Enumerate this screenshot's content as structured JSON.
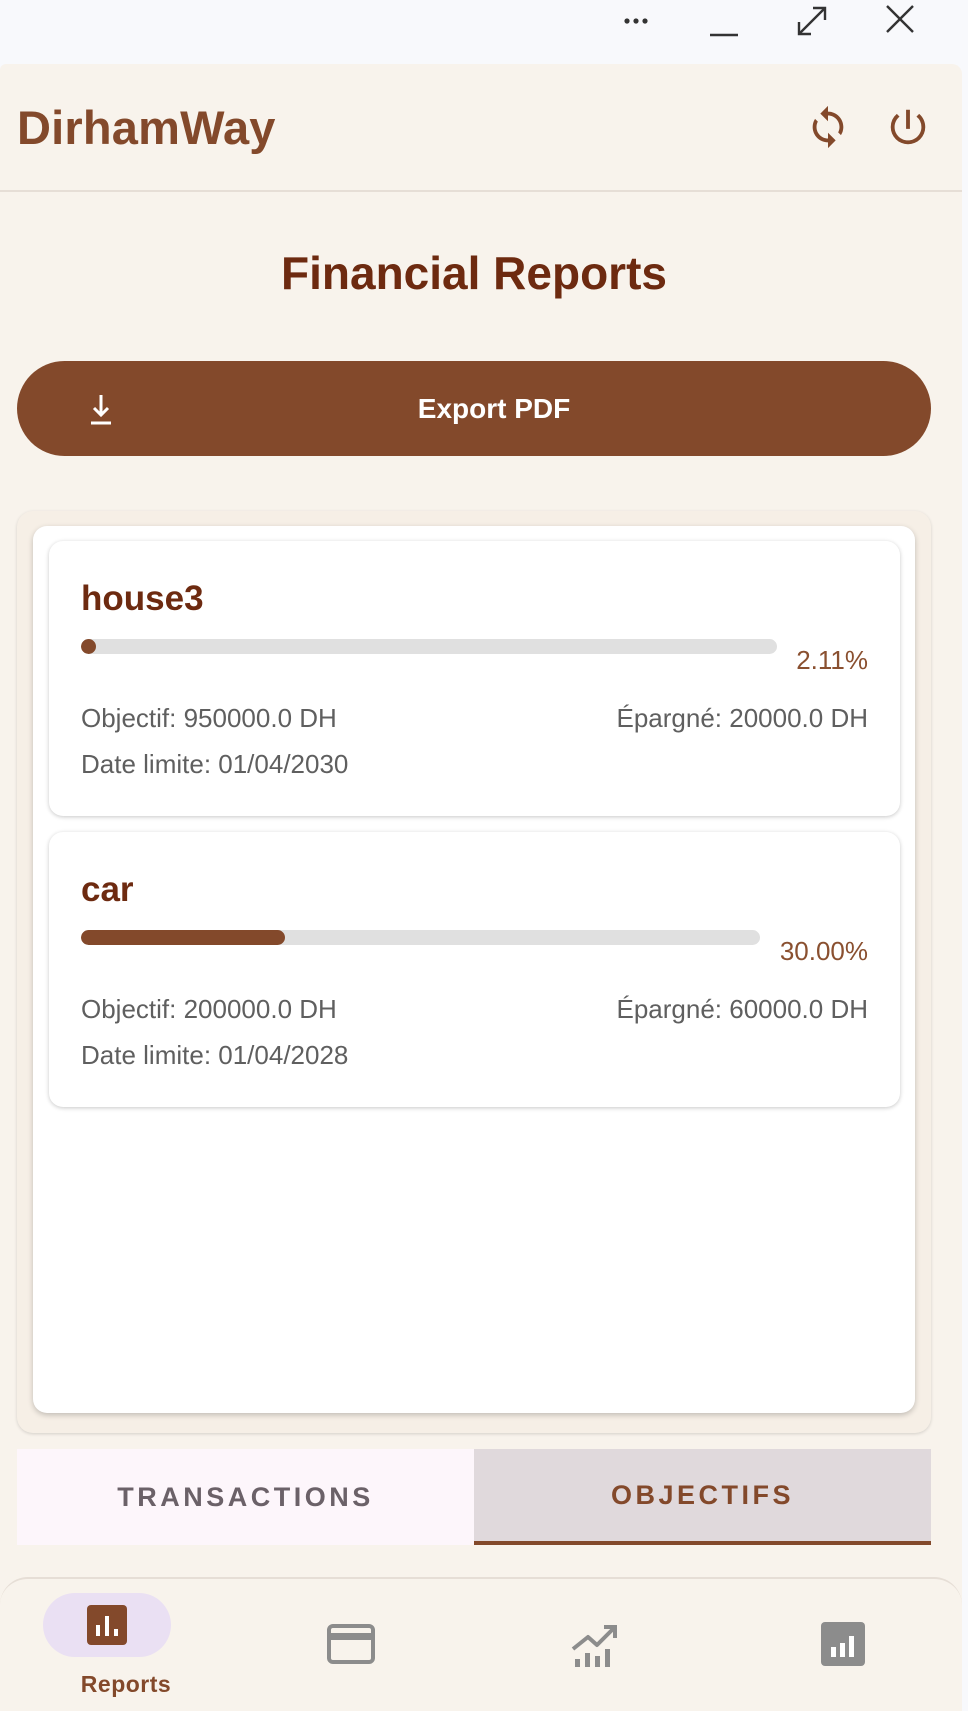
{
  "app": {
    "title": "DirhamWay",
    "colors": {
      "primary": "#83492b",
      "title": "#6d2a10",
      "background": "#f8f3ec"
    }
  },
  "window_controls": {
    "more_icon": "more-horizontal-icon",
    "minimize_icon": "minimize-icon",
    "maximize_icon": "expand-icon",
    "close_icon": "close-icon"
  },
  "topbar": {
    "refresh_icon": "refresh-icon",
    "logout_icon": "power-icon"
  },
  "page": {
    "title": "Financial Reports",
    "export_label": "Export PDF",
    "export_icon": "download-icon"
  },
  "goals": [
    {
      "name": "house3",
      "progress": 0.0211,
      "percent_label": "2.11%",
      "objective": "Objectif: 950000.0 DH",
      "saved": "Épargné: 20000.0 DH",
      "deadline": "Date limite: 01/04/2030"
    },
    {
      "name": "car",
      "progress": 0.3,
      "percent_label": "30.00%",
      "objective": "Objectif: 200000.0 DH",
      "saved": "Épargné: 60000.0 DH",
      "deadline": "Date limite: 01/04/2028"
    }
  ],
  "tabs": [
    {
      "label": "TRANSACTIONS",
      "active": false
    },
    {
      "label": "OBJECTIFS",
      "active": true
    }
  ],
  "bottom_nav": [
    {
      "label": "Reports",
      "icon": "bar-chart-icon",
      "active": true
    },
    {
      "label": "",
      "icon": "credit-card-icon",
      "active": false
    },
    {
      "label": "",
      "icon": "trending-up-icon",
      "active": false
    },
    {
      "label": "",
      "icon": "stats-square-icon",
      "active": false
    }
  ]
}
